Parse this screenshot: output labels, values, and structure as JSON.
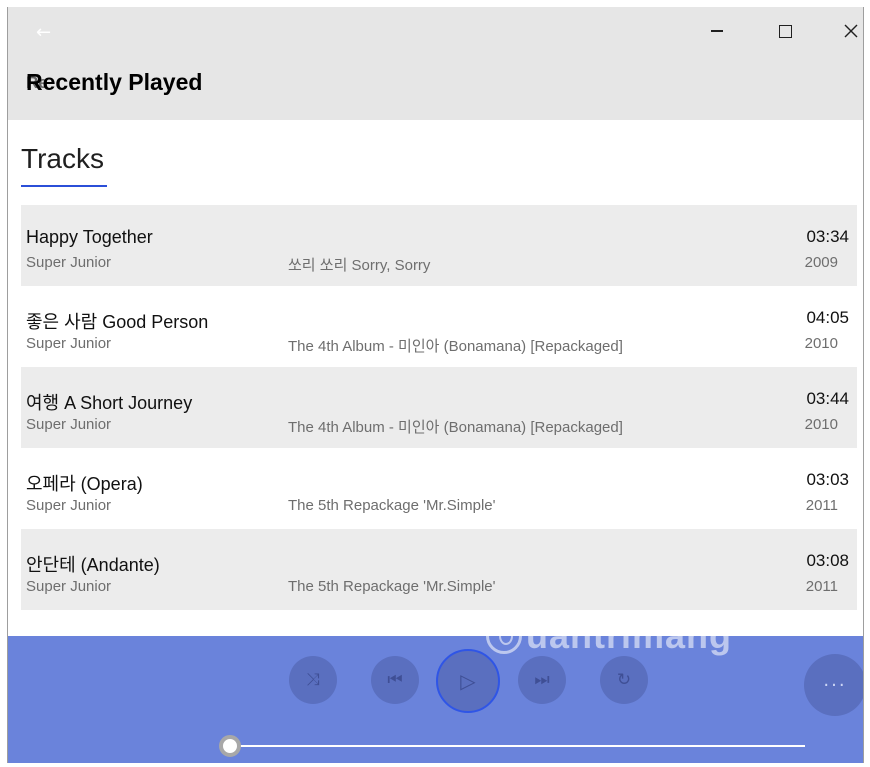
{
  "window": {
    "back_glyph": "←",
    "page_title": "Recently Played",
    "page_title_ghost": "Re"
  },
  "tabs": {
    "tracks_label": "Tracks"
  },
  "tracks": [
    {
      "title": "Happy Together",
      "artist": "Super Junior",
      "album": "쏘리 쏘리 Sorry, Sorry",
      "duration": "03:34",
      "year": "2009"
    },
    {
      "title": "좋은 사람 Good Person",
      "artist": "Super Junior",
      "album": "The 4th Album - 미인아 (Bonamana) [Repackaged]",
      "duration": "04:05",
      "year": "2010"
    },
    {
      "title": "여행 A Short Journey",
      "artist": "Super Junior",
      "album": "The 4th Album - 미인아 (Bonamana) [Repackaged]",
      "duration": "03:44",
      "year": "2010"
    },
    {
      "title": "오페라 (Opera)",
      "artist": "Super Junior",
      "album": "The 5th Repackage 'Mr.Simple'",
      "duration": "03:03",
      "year": "2011"
    },
    {
      "title": "안단테 (Andante)",
      "artist": "Super Junior",
      "album": "The 5th Repackage 'Mr.Simple'",
      "duration": "03:08",
      "year": "2011"
    }
  ],
  "player": {
    "shuffle_glyph": "⤨",
    "prev_glyph": "⏮",
    "play_glyph": "▷",
    "next_glyph": "⏭",
    "repeat_glyph": "↻",
    "more_glyph": "···",
    "progress_fraction": 0.0
  },
  "watermark": {
    "text": "uantrimang"
  },
  "colors": {
    "accent": "#2b4fd8",
    "player_bg": "#6a83db",
    "titlebar_bg": "#e6e6e6",
    "row_alt_bg": "#ececec"
  }
}
